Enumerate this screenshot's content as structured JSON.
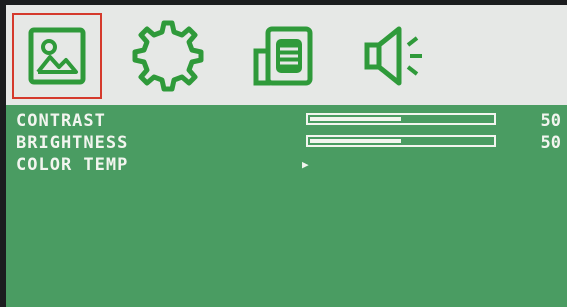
{
  "tabs": [
    {
      "icon": "picture-icon",
      "selected": true
    },
    {
      "icon": "gear-icon",
      "selected": false
    },
    {
      "icon": "document-icon",
      "selected": false
    },
    {
      "icon": "speaker-icon",
      "selected": false
    }
  ],
  "colors": {
    "accent": "#2f9a3a",
    "selection": "#d53a2c",
    "panel": "#4a9c62",
    "text": "#f2f5ef"
  },
  "menu": {
    "contrast": {
      "label": "CONTRAST",
      "value": "50",
      "level": 0.5
    },
    "brightness": {
      "label": "BRIGHTNESS",
      "value": "50",
      "level": 0.5
    },
    "color_temp": {
      "label": "COLOR TEMP",
      "arrow": "▶"
    }
  }
}
